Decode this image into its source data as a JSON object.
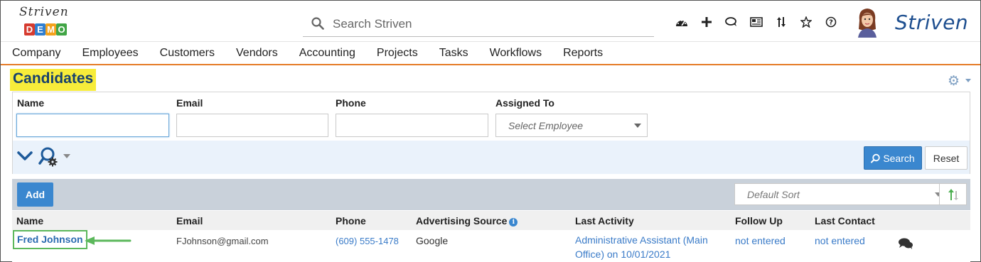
{
  "logo": {
    "script": "Striven",
    "demo_letters": [
      "D",
      "E",
      "M",
      "O"
    ],
    "demo_colors": [
      "#d63b2f",
      "#2f7fd1",
      "#f3a21c",
      "#41a546"
    ]
  },
  "search": {
    "placeholder": "Search Striven"
  },
  "header_icons": [
    "dashboard-icon",
    "plus-icon",
    "chat-icon",
    "news-icon",
    "sort-arrows-icon",
    "star-icon",
    "help-icon"
  ],
  "brand": "Striven",
  "nav": [
    "Company",
    "Employees",
    "Customers",
    "Vendors",
    "Accounting",
    "Projects",
    "Tasks",
    "Workflows",
    "Reports"
  ],
  "page": {
    "title": "Candidates"
  },
  "filters": {
    "name_label": "Name",
    "email_label": "Email",
    "phone_label": "Phone",
    "assigned_label": "Assigned To",
    "assigned_placeholder": "Select Employee",
    "search_button": "Search",
    "reset_button": "Reset"
  },
  "results": {
    "add_button": "Add",
    "sort_placeholder": "Default Sort",
    "columns": [
      "Name",
      "Email",
      "Phone",
      "Advertising Source",
      "Last Activity",
      "Follow Up",
      "Last Contact"
    ],
    "rows": [
      {
        "name": "Fred Johnson",
        "email": "FJohnson@gmail.com",
        "phone": "(609) 555-1478",
        "source": "Google",
        "activity_line1": "Administrative Assistant (Main",
        "activity_line2": "Office) on 10/01/2021",
        "follow_up": "not entered",
        "last_contact": "not entered"
      }
    ]
  },
  "colors": {
    "accent_orange": "#e57b26",
    "highlight": "#f7ec3a",
    "primary_blue": "#3a87cf",
    "annotation_green": "#5cb85c"
  }
}
